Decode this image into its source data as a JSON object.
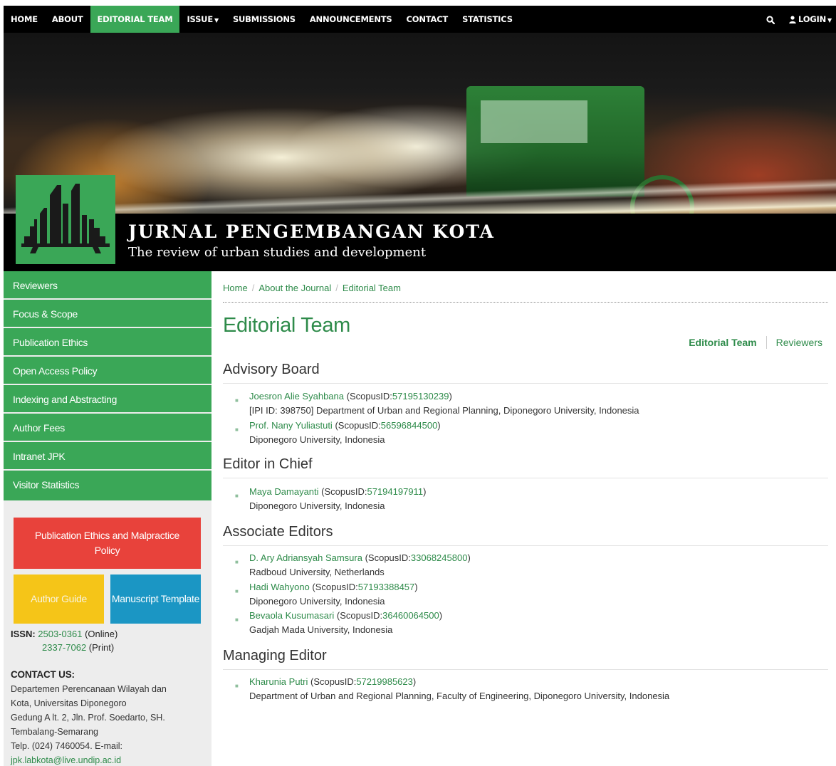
{
  "nav": {
    "home": "HOME",
    "about": "ABOUT",
    "editorial_team": "EDITORIAL TEAM",
    "issue": "ISSUE",
    "submissions": "SUBMISSIONS",
    "announcements": "ANNOUNCEMENTS",
    "contact": "CONTACT",
    "statistics": "STATISTICS",
    "login": "LOGIN"
  },
  "banner": {
    "title": "JURNAL PENGEMBANGAN KOTA",
    "subtitle": "The review of urban studies and development"
  },
  "sidebar": {
    "menu": [
      "Reviewers",
      "Focus & Scope",
      "Publication Ethics",
      "Open Access Policy",
      "Indexing and Abstracting",
      "Author Fees",
      "Intranet JPK",
      "Visitor Statistics"
    ],
    "ethics_button": "Publication Ethics and Malpractice Policy",
    "author_guide_button": "Author Guide",
    "template_button": "Manuscript Template",
    "issn_label": "ISSN:",
    "issn_online": "2503-0361",
    "issn_online_note": "(Online)",
    "issn_print": "2337-7062",
    "issn_print_note": "(Print)",
    "contact_title": "CONTACT US:",
    "contact_lines": [
      "Departemen Perencanaan Wilayah dan",
      "Kota, Universitas Diponegoro",
      "Gedung A lt. 2, Jln. Prof. Soedarto, SH.",
      "Tembalang-Semarang",
      "Telp. (024) 7460054. E-mail:"
    ],
    "contact_email": "jpk.labkota@live.undip.ac.id"
  },
  "breadcrumb": [
    "Home",
    "About the Journal",
    "Editorial Team"
  ],
  "page_title": "Editorial Team",
  "page_links": {
    "current": "Editorial Team",
    "other": "Reviewers"
  },
  "sections": [
    {
      "heading": "Advisory Board",
      "members": [
        {
          "name": "Joesron Alie Syahbana",
          "scopus_prefix": "(ScopusID:",
          "scopus_id": "57195130239",
          "scopus_suffix": ")",
          "affiliation": "[IPI ID: 398750] Department of Urban and Regional Planning, Diponegoro University, Indonesia"
        },
        {
          "name": "Prof. Nany Yuliastuti",
          "scopus_prefix": "(ScopusID:",
          "scopus_id": "56596844500",
          "scopus_suffix": ")",
          "affiliation": "Diponegoro University, Indonesia"
        }
      ]
    },
    {
      "heading": "Editor in Chief",
      "members": [
        {
          "name": "Maya Damayanti",
          "scopus_prefix": "(ScopusID:",
          "scopus_id": "57194197911",
          "scopus_suffix": ")",
          "affiliation": "Diponegoro University, Indonesia"
        }
      ]
    },
    {
      "heading": "Associate Editors",
      "members": [
        {
          "name": "D. Ary Adriansyah Samsura",
          "scopus_prefix": "(ScopusID:",
          "scopus_id": "33068245800",
          "scopus_suffix": ")",
          "affiliation": "Radboud University, Netherlands"
        },
        {
          "name": "Hadi Wahyono",
          "scopus_prefix": "(ScopusID:",
          "scopus_id": "57193388457",
          "scopus_suffix": ")",
          "affiliation": "Diponegoro University, Indonesia"
        },
        {
          "name": "Bevaola Kusumasari",
          "scopus_prefix": "(ScopusID:",
          "scopus_id": "36460064500",
          "scopus_suffix": ")",
          "affiliation": "Gadjah Mada University, Indonesia"
        }
      ]
    },
    {
      "heading": "Managing Editor",
      "members": [
        {
          "name": "Kharunia Putri",
          "scopus_prefix": "(ScopusID:",
          "scopus_id": "57219985623",
          "scopus_suffix": ")",
          "affiliation": "Department of Urban and Regional Planning, Faculty of Engineering, Diponegoro University, Indonesia"
        }
      ]
    }
  ],
  "icons": {
    "search": "search-icon",
    "user": "user-icon",
    "bullet": "square-bullet-icon",
    "logo": "city-skyline-logo"
  },
  "colors": {
    "accent_green": "#3aa757",
    "link_green": "#2e8b4a",
    "ethics_red": "#e8423b",
    "guide_yellow": "#f5c518",
    "template_blue": "#1b96c4",
    "nav_black": "#000000"
  }
}
